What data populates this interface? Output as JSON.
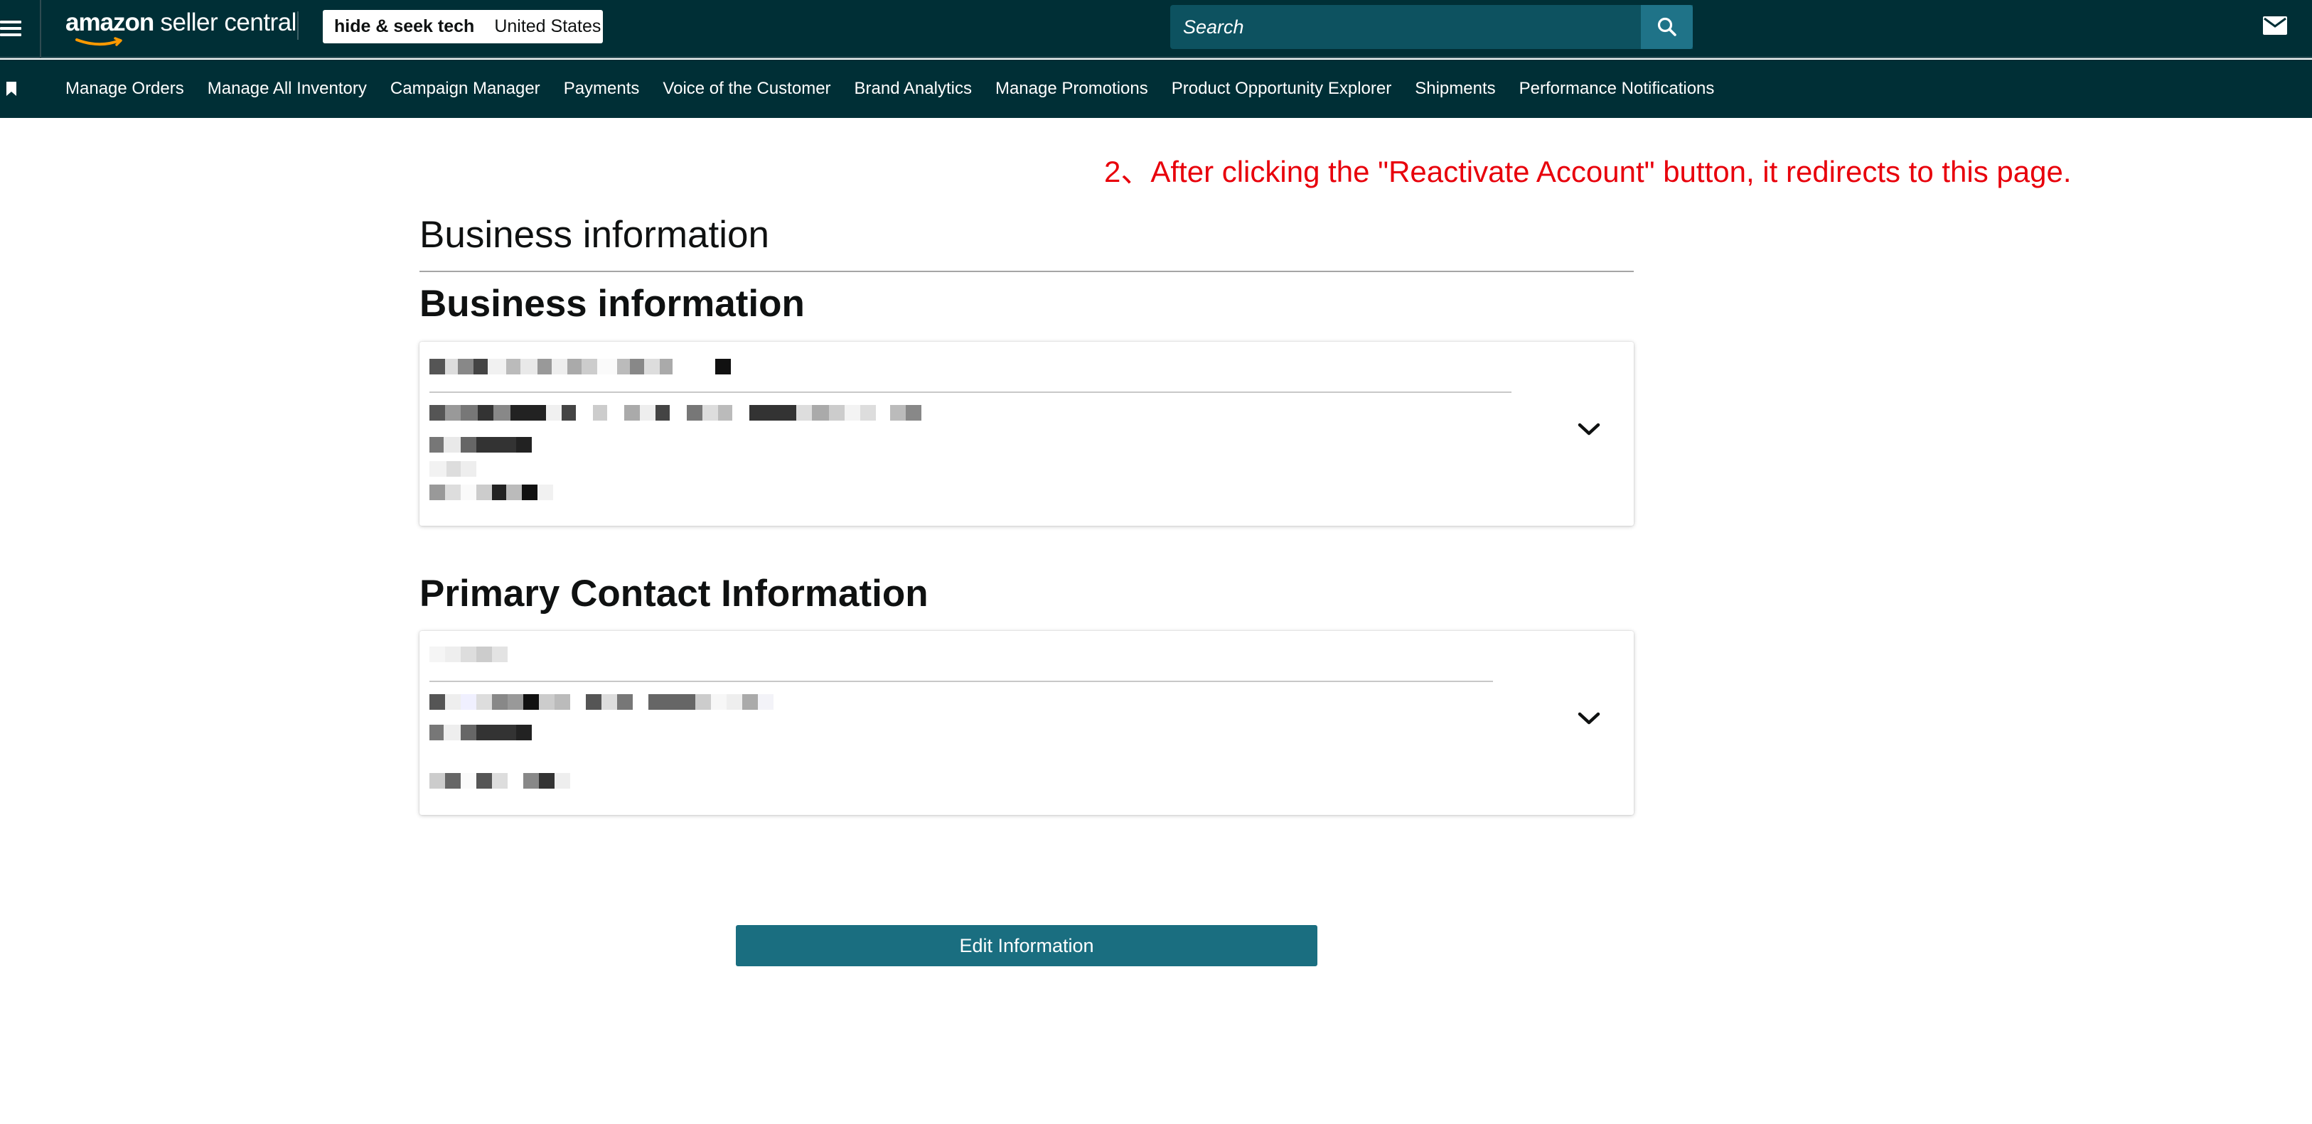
{
  "header": {
    "logo_brand": "amazon",
    "logo_rest": " seller central",
    "store_name": "hide & seek tech",
    "marketplace": "United States",
    "search_placeholder": "Search"
  },
  "nav": {
    "items": [
      "Manage Orders",
      "Manage All Inventory",
      "Campaign Manager",
      "Payments",
      "Voice of the Customer",
      "Brand Analytics",
      "Manage Promotions",
      "Product Opportunity Explorer",
      "Shipments",
      "Performance Notifications"
    ]
  },
  "annotation": "2、After clicking the \"Reactivate Account\" button, it redirects to this page.",
  "content": {
    "page_title": "Business information",
    "section1_title": "Business information",
    "section2_title": "Primary Contact Information",
    "edit_button": "Edit Information"
  },
  "colors": {
    "header_bg": "#002f36",
    "search_bg": "#0d5260",
    "search_btn": "#1f7388",
    "button_bg": "#1a6e80",
    "annotation": "#e8000b"
  },
  "icons": {
    "menu": "hamburger-icon",
    "search": "search-icon",
    "mail": "mail-icon",
    "bookmark": "bookmark-icon",
    "expand": "chevron-down-icon"
  }
}
